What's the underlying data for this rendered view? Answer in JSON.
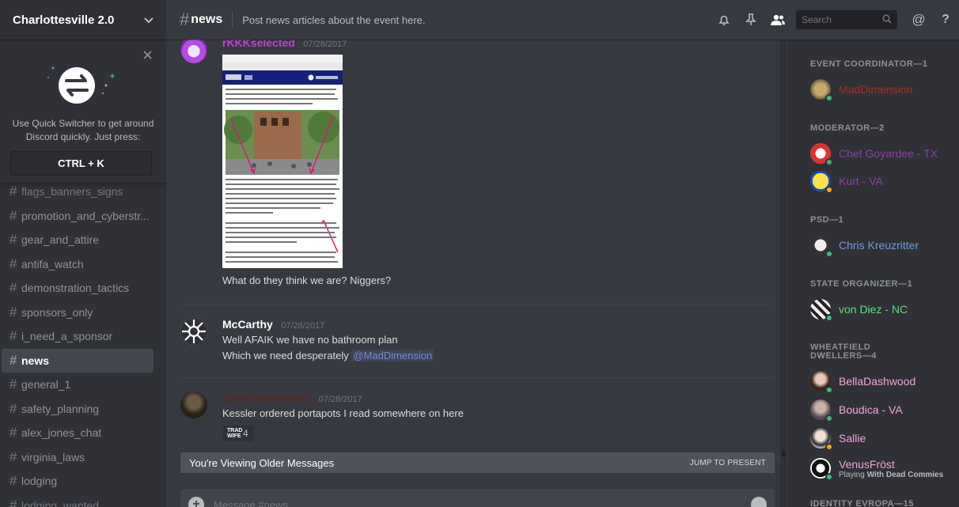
{
  "guild": {
    "name": "Charlottesville 2.0"
  },
  "quick_switcher": {
    "text": "Use Quick Switcher to get around Discord quickly. Just press:",
    "shortcut": "CTRL + K"
  },
  "channels": [
    {
      "name": "flags_banners_signs",
      "state": "partial"
    },
    {
      "name": "promotion_and_cyberstr...",
      "state": "normal"
    },
    {
      "name": "gear_and_attire",
      "state": "normal"
    },
    {
      "name": "antifa_watch",
      "state": "normal"
    },
    {
      "name": "demonstration_tactics",
      "state": "normal"
    },
    {
      "name": "sponsors_only",
      "state": "normal"
    },
    {
      "name": "i_need_a_sponsor",
      "state": "normal"
    },
    {
      "name": "news",
      "state": "active"
    },
    {
      "name": "general_1",
      "state": "normal"
    },
    {
      "name": "safety_planning",
      "state": "normal"
    },
    {
      "name": "alex_jones_chat",
      "state": "normal"
    },
    {
      "name": "virginia_laws",
      "state": "normal"
    },
    {
      "name": "lodging",
      "state": "normal"
    },
    {
      "name": "lodging_wanted",
      "state": "partial"
    }
  ],
  "topbar": {
    "channel": "news",
    "topic": "Post news articles about the event here.",
    "search_placeholder": "Search"
  },
  "messages": [
    {
      "author": "rKKKselected",
      "author_color": "#c43fd9",
      "timestamp": "07/28/2017",
      "lines": [
        "What do they think we are? Niggers?"
      ],
      "has_image": true
    },
    {
      "author": "McCarthy",
      "author_color": "#ffffff",
      "timestamp": "07/28/2017",
      "lines": [
        "Well AFAIK we have no bathroom plan",
        "Which we need desperately"
      ],
      "mention": "@MadDimension"
    },
    {
      "author": "Stannisthemannis",
      "author_color": "#6b1d1d",
      "timestamp": "07/28/2017",
      "lines": [
        "Kessler ordered portapots I read somewhere on here"
      ],
      "reaction": {
        "emoji": "TRAD WIFE",
        "count": "4"
      }
    }
  ],
  "older_bar": {
    "text": "You're Viewing Older Messages",
    "jump": "JUMP TO PRESENT"
  },
  "composer": {
    "placeholder": "Message #news"
  },
  "members": {
    "roles": [
      {
        "title": "EVENT COORDINATOR—1"
      },
      {
        "title": "MODERATOR—2"
      },
      {
        "title": "PSD—1"
      },
      {
        "title": "STATE ORGANIZER—1"
      },
      {
        "title": "WHEATFIELD DWELLERS—4"
      },
      {
        "title": "IDENTITY EVROPA—15"
      }
    ],
    "list": [
      {
        "name": "MadDimension",
        "color": "#a82d22",
        "status": "#43b581"
      },
      {
        "name": "Chef Goyardee - TX",
        "color": "#8a3fa8",
        "status": "#43b581"
      },
      {
        "name": "Kurt - VA",
        "color": "#8a3fa8",
        "status": "#faa61a"
      },
      {
        "name": "Chris Kreuzritter",
        "color": "#6f9bdc",
        "status": "#43b581"
      },
      {
        "name": "von Diez - NC",
        "color": "#5ee07a",
        "status": "#43b581"
      },
      {
        "name": "BellaDashwood",
        "color": "#f5a3d8",
        "status": "#43b581"
      },
      {
        "name": "Boudica - VA",
        "color": "#f5a3d8",
        "status": "#43b581"
      },
      {
        "name": "Sallie",
        "color": "#f5a3d8",
        "status": "#faa61a"
      },
      {
        "name": "VenusFröst",
        "color": "#f5a3d8",
        "status": "#43b581",
        "game_prefix": "Playing ",
        "game": "With Dead Commies"
      }
    ]
  }
}
